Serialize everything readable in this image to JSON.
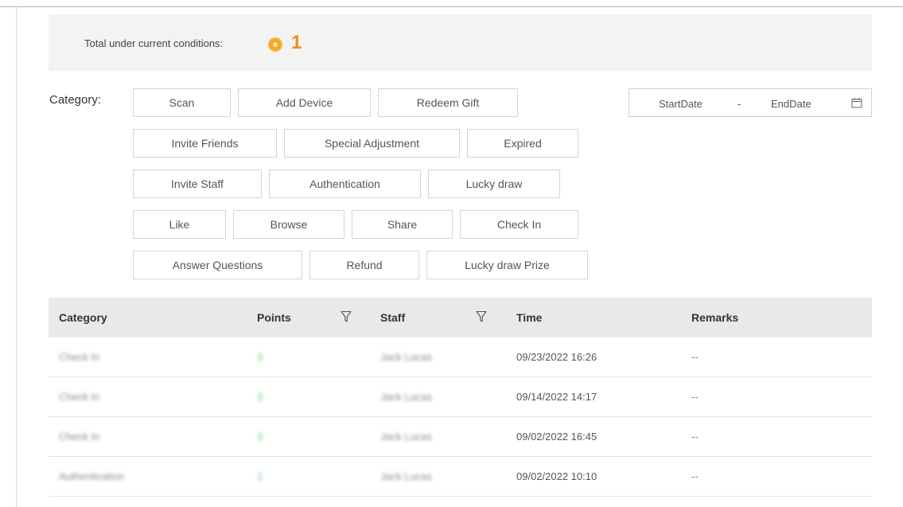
{
  "summary": {
    "label": "Total under current conditions:",
    "count": "1",
    "icon": "coin-icon"
  },
  "filters": {
    "label": "Category:",
    "chips": [
      "Scan",
      "Add Device",
      "Redeem Gift",
      "Invite Friends",
      "Special Adjustment",
      "Expired",
      "Invite Staff",
      "Authentication",
      "Lucky draw",
      "Like",
      "Browse",
      "Share",
      "Check In",
      "Answer Questions",
      "Refund",
      "Lucky draw Prize"
    ]
  },
  "date_range": {
    "start_placeholder": "StartDate",
    "separator": "-",
    "end_placeholder": "EndDate",
    "icon": "calendar-icon"
  },
  "table": {
    "columns": [
      "Category",
      "Points",
      "Staff",
      "Time",
      "Remarks"
    ],
    "rows": [
      {
        "category": "Check In",
        "points": "3",
        "staff": "Jack Lucas",
        "time": "09/23/2022 16:26",
        "remarks": "--"
      },
      {
        "category": "Check In",
        "points": "3",
        "staff": "Jack Lucas",
        "time": "09/14/2022 14:17",
        "remarks": "--"
      },
      {
        "category": "Check In",
        "points": "3",
        "staff": "Jack Lucas",
        "time": "09/02/2022 16:45",
        "remarks": "--"
      },
      {
        "category": "Authentication",
        "points": "1",
        "staff": "Jack Lucas",
        "time": "09/02/2022 10:10",
        "remarks": "--"
      }
    ]
  },
  "colors": {
    "accent": "#f08c1e",
    "points": "#6cc26c",
    "header_bg": "#e9e9e9",
    "summary_bg": "#f3f3f3"
  }
}
